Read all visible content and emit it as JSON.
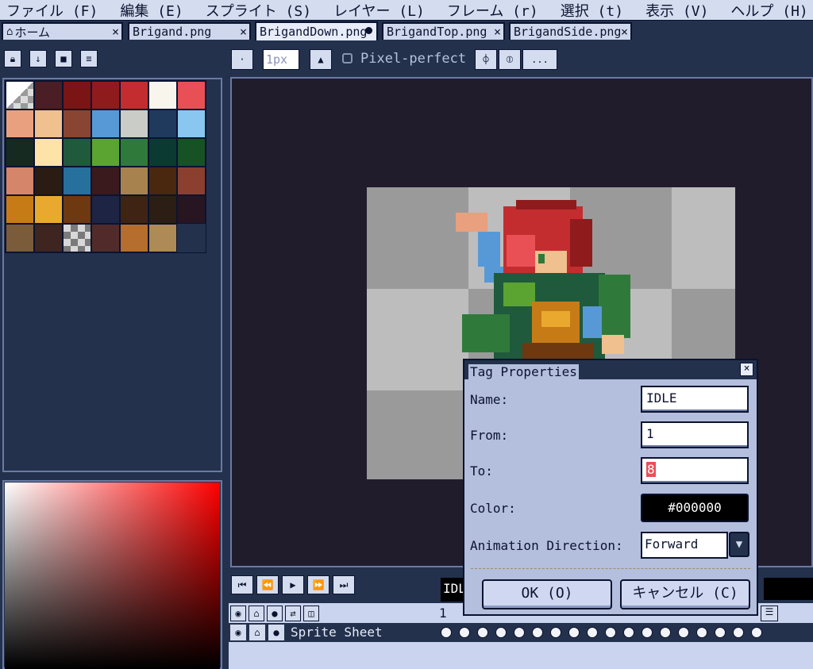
{
  "menubar": {
    "items": [
      "ファイル (F)",
      "編集 (E)",
      "スプライト (S)",
      "レイヤー (L)",
      "フレーム (r)",
      "選択 (t)",
      "表示 (V)",
      "ヘルプ (H)"
    ]
  },
  "tabs": [
    {
      "label": "ホーム",
      "close": "×"
    },
    {
      "label": "Brigand.png",
      "close": "×"
    },
    {
      "label": "BrigandDown.png"
    },
    {
      "label": "BrigandTop.png",
      "close": "×"
    },
    {
      "label": "BrigandSide.png",
      "close": "×"
    }
  ],
  "toolbar": {
    "brush_size": "1px",
    "pixel_perfect_label": "Pixel-perfect",
    "more_label": "..."
  },
  "palette": {
    "colors": [
      "transparent",
      "#4a1e24",
      "#7b1414",
      "#8f1b1d",
      "#c42d2f",
      "#f7f5ec",
      "#e85056",
      "#e9a07e",
      "#f0c08f",
      "#8a4532",
      "#5799d6",
      "#c9ccc7",
      "#1f3a5c",
      "#89c7f0",
      "#172a22",
      "#fde3a8",
      "#1f5a3c",
      "#5ba431",
      "#2f7a3a",
      "#0b3a33",
      "#175225",
      "#d4856a",
      "#2a1c13",
      "#26709e",
      "#3a1a1c",
      "#a8824e",
      "#4a270f",
      "#8b3f2e",
      "#c77b17",
      "#e9a92f",
      "#6e3811",
      "#1e2444",
      "#3f2313",
      "#2c1e14",
      "#271522",
      "#7a5c3a",
      "#3e2520",
      "checker",
      "#512b2a",
      "#b56e2d",
      "#ad8a56"
    ]
  },
  "timeline": {
    "layer_name": "Sprite Sheet",
    "frame_header": "1",
    "tag_label": "IDLE"
  },
  "tag_dialog": {
    "title": "Tag Properties",
    "close": "×",
    "name_label": "Name:",
    "name_value": "IDLE",
    "from_label": "From:",
    "from_value": "1",
    "to_label": "To:",
    "to_value": "8",
    "color_label": "Color:",
    "color_value": "#000000",
    "direction_label": "Animation Direction:",
    "direction_value": "Forward",
    "ok_label": "OK (O)",
    "cancel_label": "キャンセル (C)"
  }
}
